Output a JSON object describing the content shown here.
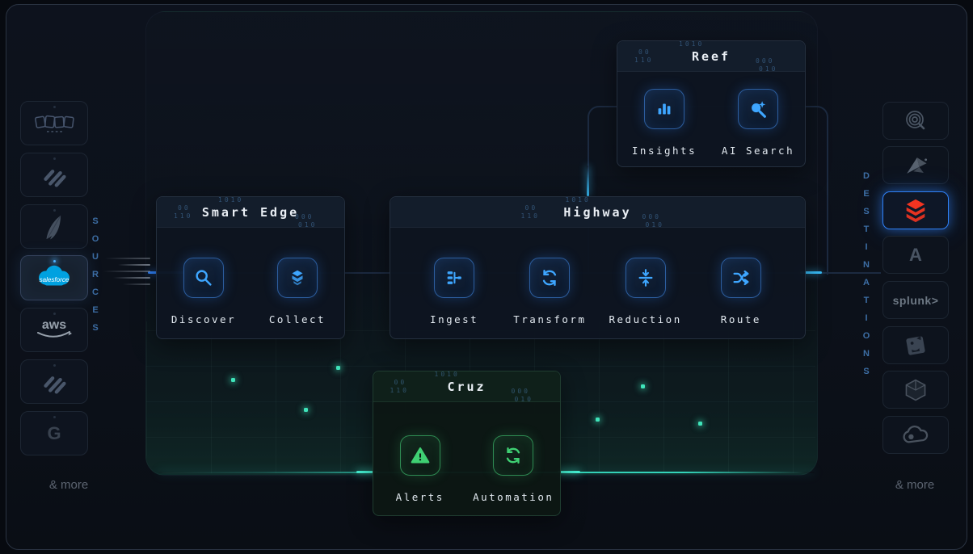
{
  "rails": {
    "sources": {
      "label": "SOURCES",
      "more": "& more",
      "items": [
        {
          "name": "boxes-logo"
        },
        {
          "name": "diagonal-stripes-logo"
        },
        {
          "name": "apache-feather-logo"
        },
        {
          "name": "salesforce-logo",
          "text": "salesforce",
          "active": true
        },
        {
          "name": "aws-logo",
          "text": "aws"
        },
        {
          "name": "diagonal-stripes-logo"
        },
        {
          "name": "google-logo",
          "text": "G"
        }
      ]
    },
    "destinations": {
      "label": "DESTINATIONS",
      "more": "& more",
      "items": [
        {
          "name": "q-spiral-logo"
        },
        {
          "name": "origami-bird-logo"
        },
        {
          "name": "databricks-logo",
          "active": true
        },
        {
          "name": "azure-a-logo",
          "text": "A"
        },
        {
          "name": "splunk-logo",
          "text": "splunk>"
        },
        {
          "name": "datadog-logo"
        },
        {
          "name": "cube-logo"
        },
        {
          "name": "cloud-logo"
        }
      ]
    }
  },
  "panels": {
    "reef": {
      "title": "Reef",
      "items": [
        {
          "label": "Insights",
          "icon": "bar-chart-icon"
        },
        {
          "label": "AI Search",
          "icon": "ai-search-icon"
        }
      ]
    },
    "smart_edge": {
      "title": "Smart Edge",
      "items": [
        {
          "label": "Discover",
          "icon": "magnifier-icon"
        },
        {
          "label": "Collect",
          "icon": "collect-box-icon"
        }
      ]
    },
    "highway": {
      "title": "Highway",
      "items": [
        {
          "label": "Ingest",
          "icon": "merge-icon"
        },
        {
          "label": "Transform",
          "icon": "sync-icon"
        },
        {
          "label": "Reduction",
          "icon": "compress-icon"
        },
        {
          "label": "Route",
          "icon": "shuffle-icon"
        }
      ]
    },
    "cruz": {
      "title": "Cruz",
      "items": [
        {
          "label": "Alerts",
          "icon": "warning-icon"
        },
        {
          "label": "Automation",
          "icon": "sync-green-icon"
        }
      ]
    }
  },
  "decor": {
    "b1": "1010",
    "b2": "00",
    "b3": "110",
    "b4": "000",
    "b5": "010"
  },
  "colors": {
    "accent_blue": "#2f81f7",
    "icon_blue": "#3ea6ff",
    "accent_cyan": "#38bdf8",
    "accent_teal": "#2dd4bf",
    "accent_green": "#3fd073",
    "databricks_red": "#ff3621",
    "salesforce_blue": "#00a1e0"
  }
}
